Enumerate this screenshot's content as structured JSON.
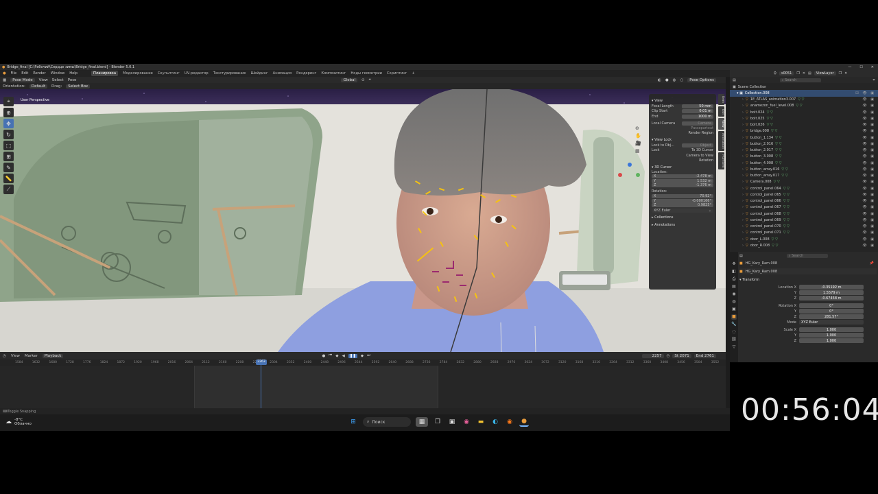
{
  "window": {
    "title": "Bridge_final [C:\\Рабочий\\Сердце зимы\\Bridge_final.blend] - Blender 5.0.1"
  },
  "menu": [
    "File",
    "Edit",
    "Render",
    "Window",
    "Help"
  ],
  "workspaces": [
    "Планировка",
    "Моделирование",
    "Скульптинг",
    "UV-редактор",
    "Текстурирование",
    "Шейдинг",
    "Анимация",
    "Рендеринг",
    "Композитинг",
    "Ноды геометрии",
    "Скриптинг"
  ],
  "active_workspace_index": 0,
  "viewport_header": {
    "mode": "Pose Mode",
    "view": "View",
    "select": "Select",
    "pose": "Pose",
    "transform": "Global",
    "pose_options": "Pose Options"
  },
  "tool_header": {
    "orientation_label": "Orientation:",
    "orientation": "Default",
    "drag_label": "Drag:",
    "drag": "Select Box"
  },
  "viewport": {
    "label": "User Perspective"
  },
  "n_panel": {
    "view_title": "View",
    "focal_length_label": "Focal Length",
    "focal_length": "50 mm",
    "clip_start_label": "Clip Start",
    "clip_start": "0.01 m",
    "end_label": "End",
    "end": "1000 m",
    "local_camera_label": "Local Camera",
    "local_camera": "Camera",
    "passepartout": "Passepartout",
    "render_region": "Render Region",
    "view_lock_title": "View Lock",
    "lock_to_object_label": "Lock to Obj...",
    "lock_to_object": "Object",
    "lock_label": "Lock",
    "to_3d_cursor": "To 3D Cursor",
    "camera_to_view": "Camera to View",
    "rotation_opt": "Rotation",
    "cursor_title": "3D Cursor",
    "location_label": "Location:",
    "loc_x": "-2.478 m",
    "loc_y": "1.532 m",
    "loc_z": "-1.376 m",
    "rotation_label": "Rotation:",
    "rot_x": "70.92°",
    "rot_y": "-0.000166°",
    "rot_z": "0.9825°",
    "rotation_mode": "XYZ Euler",
    "collections": "Collections",
    "annotations": "Annotations"
  },
  "n_tabs": [
    "Item",
    "Tool",
    "View",
    "Animation",
    "HumGen"
  ],
  "timeline": {
    "playback": "Playback",
    "view": "View",
    "marker": "Marker",
    "current_frame": "2257",
    "start_label": "St",
    "start": "2071",
    "end_label": "End",
    "end": "2761",
    "playhead_frame": "2263",
    "ticks": [
      "1584",
      "1632",
      "1680",
      "1728",
      "1776",
      "1824",
      "1872",
      "1920",
      "1968",
      "2016",
      "2064",
      "2112",
      "2160",
      "2208",
      "2256",
      "2304",
      "2352",
      "2400",
      "2448",
      "2496",
      "2544",
      "2592",
      "2640",
      "2688",
      "2736",
      "2784",
      "2832",
      "2880",
      "2928",
      "2976",
      "3024",
      "3072",
      "3120",
      "3168",
      "3216",
      "3264",
      "3312",
      "3360",
      "3408",
      "3456",
      "3504",
      "3552"
    ]
  },
  "status": {
    "hint": "Toggle Snapping"
  },
  "outliner": {
    "scene": "s0051",
    "view_layer": "ViewLayer",
    "search_placeholder": "Search",
    "root": "Scene Collection",
    "collection": "Collection.008",
    "items": [
      "1E_ATLAS_animation3.007",
      "anamezon_fuel_level.008",
      "bolt.024",
      "bolt.025",
      "bolt.026",
      "bridge.008",
      "button_1.134",
      "button_2.016",
      "button_2.017",
      "button_3.008",
      "button_4.008",
      "button_array.016",
      "button_array.017",
      "Camera.008",
      "control_panel.064",
      "control_panel.065",
      "control_panel.066",
      "control_panel.067",
      "control_panel.068",
      "control_panel.069",
      "control_panel.070",
      "control_panel.071",
      "door_L.008",
      "door_R.008"
    ]
  },
  "properties": {
    "search_placeholder": "Search",
    "object": "HG_Kary_Ram.008",
    "object_name": "HG_Kary_Ram.008",
    "transform_title": "Transform",
    "location_x_label": "Location X",
    "loc_x": "-0.35192 m",
    "loc_y": "1.5579 m",
    "loc_z": "-0.67458 m",
    "rotation_x_label": "Rotation X",
    "rot_x": "0°",
    "rot_y": "0°",
    "rot_z": "281.57°",
    "mode_label": "Mode",
    "mode": "XYZ Euler",
    "scale_x_label": "Scale X",
    "scale_x": "1.000",
    "scale_y": "1.000",
    "scale_z": "1.000",
    "y_label": "Y",
    "z_label": "Z"
  },
  "stopwatch": "00:56:04",
  "taskbar": {
    "temperature": "-8°C",
    "weather": "Облачно",
    "search": "Поиск"
  },
  "colors": {
    "accent": "#4772b3",
    "selection": "#334c70",
    "bone": "#f5c211",
    "shirt": "#8e9fe0"
  }
}
